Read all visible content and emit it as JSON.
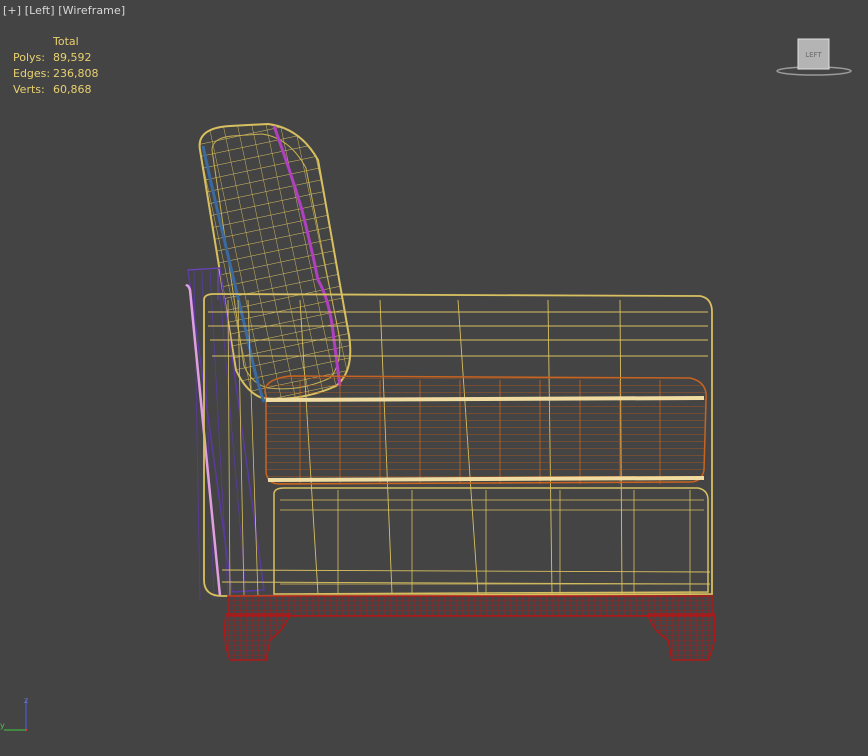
{
  "viewport": {
    "plus_label": "[+]",
    "view_label": "[Left]",
    "shading_label": "[Wireframe]"
  },
  "stats": {
    "header": "Total",
    "rows": [
      {
        "label": "Polys:",
        "value": "89,592"
      },
      {
        "label": "Edges:",
        "value": "236,808"
      },
      {
        "label": "Verts:",
        "value": "60,868"
      }
    ]
  },
  "viewcube": {
    "face_label": "LEFT"
  },
  "axis": {
    "z_label": "z",
    "y_label": "y"
  },
  "colors": {
    "background": "#444444",
    "wire_yellow": "#d8c060",
    "wire_cream": "#f0dca0",
    "wire_orange": "#c86420",
    "wire_red": "#b01818",
    "wire_blue": "#3a6aa0",
    "wire_magenta": "#b040c0",
    "wire_purple": "#5a3aa0",
    "wire_pink": "#e0a0e0",
    "stats_text": "#e8d070"
  }
}
